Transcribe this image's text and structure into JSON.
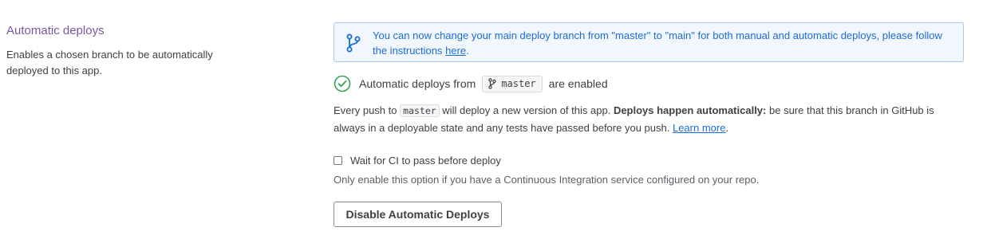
{
  "section": {
    "title": "Automatic deploys",
    "description": "Enables a chosen branch to be automatically deployed to this app."
  },
  "notice": {
    "icon": "git-branch-icon",
    "text": "You can now change your main deploy branch from \"master\" to \"main\" for both manual and automatic deploys, please follow the instructions",
    "link_label": "here",
    "trailing": "."
  },
  "status": {
    "icon": "check-circle-icon",
    "prefix": "Automatic deploys from",
    "branch": "master",
    "suffix": "are enabled"
  },
  "description": {
    "part1": "Every push to",
    "branch": "master",
    "part2": "will deploy a new version of this app.",
    "bold": "Deploys happen automatically:",
    "part3": "be sure that this branch in GitHub is always in a deployable state and any tests have passed before you push.",
    "link_label": "Learn more",
    "trailing": "."
  },
  "ci_option": {
    "label": "Wait for CI to pass before deploy",
    "checked": false,
    "help": "Only enable this option if you have a Continuous Integration service configured on your repo."
  },
  "actions": {
    "disable_label": "Disable Automatic Deploys"
  },
  "colors": {
    "title": "#79589f",
    "link": "#1a6cd8",
    "success": "#2fa44f"
  }
}
